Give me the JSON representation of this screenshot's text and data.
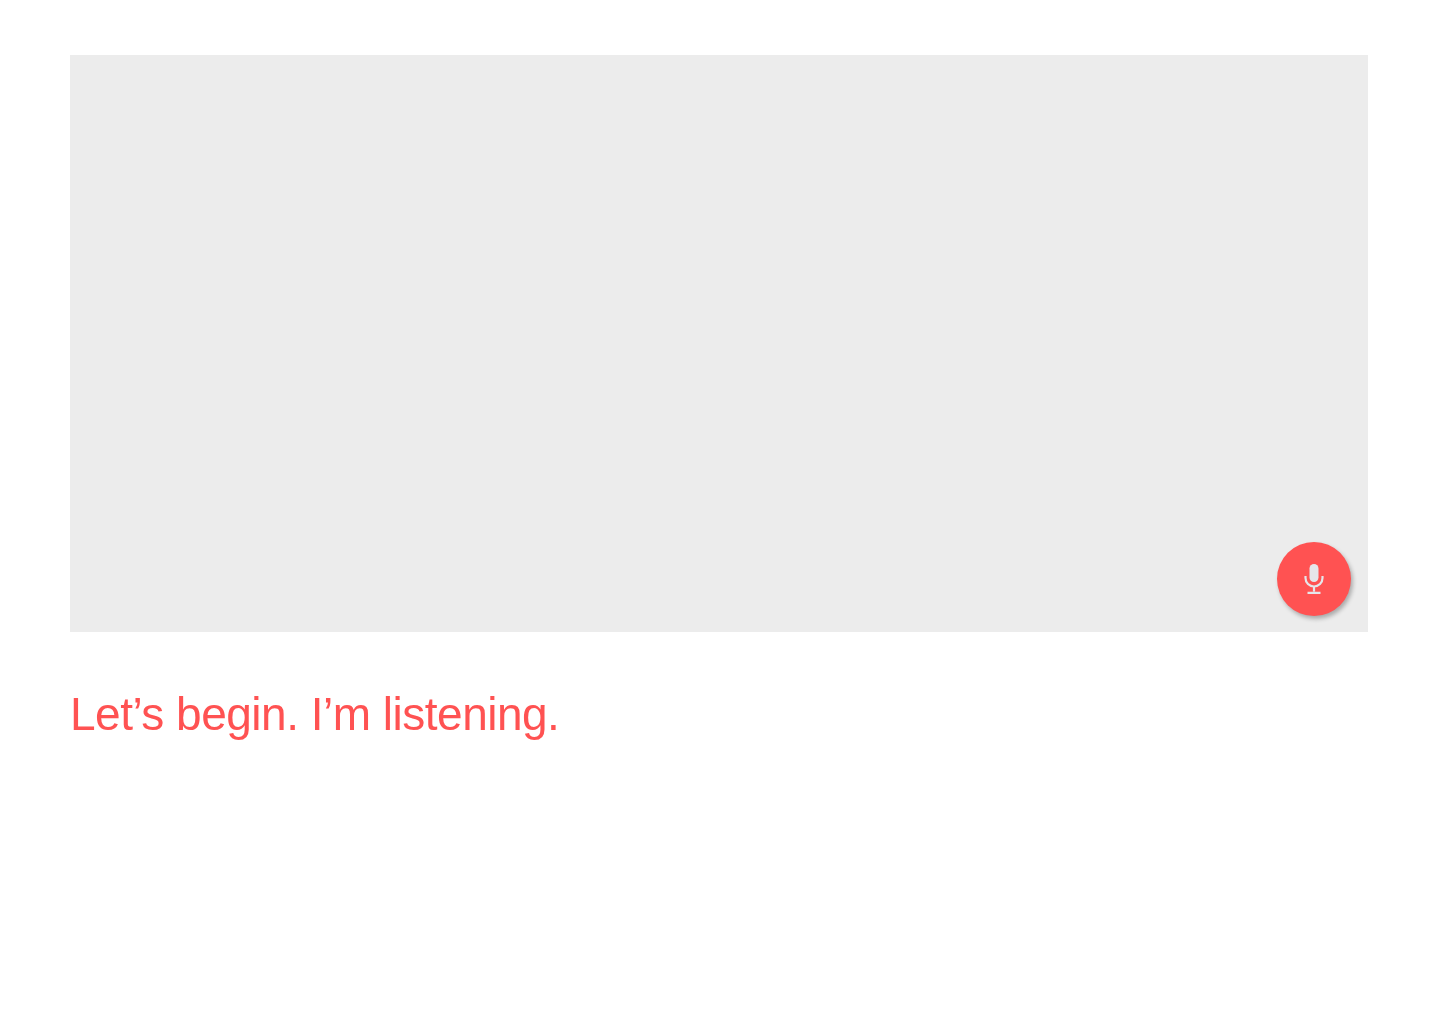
{
  "prompt": {
    "text": "Let’s begin. I’m listening."
  }
}
